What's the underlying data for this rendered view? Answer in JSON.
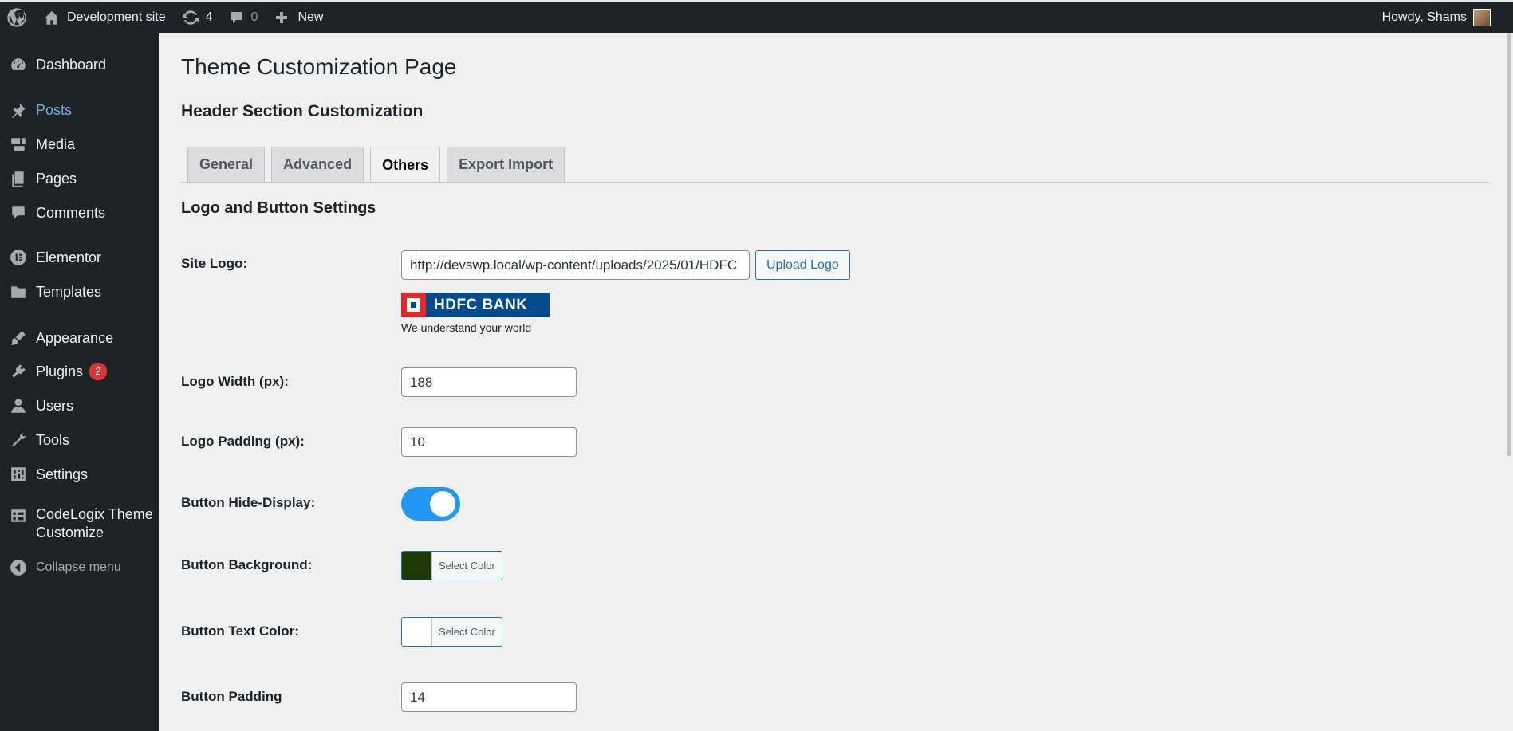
{
  "adminbar": {
    "site_name": "Development site",
    "updates_count": "4",
    "comments_count": "0",
    "new_label": "New",
    "howdy": "Howdy, Shams"
  },
  "sidebar": {
    "items": [
      {
        "label": "Dashboard",
        "icon": "dashboard-icon"
      },
      {
        "label": "Posts",
        "icon": "pin-icon"
      },
      {
        "label": "Media",
        "icon": "media-icon"
      },
      {
        "label": "Pages",
        "icon": "pages-icon"
      },
      {
        "label": "Comments",
        "icon": "comment-icon"
      },
      {
        "label": "Elementor",
        "icon": "elementor-icon"
      },
      {
        "label": "Templates",
        "icon": "folder-icon"
      },
      {
        "label": "Appearance",
        "icon": "brush-icon"
      },
      {
        "label": "Plugins",
        "icon": "plug-icon",
        "badge": "2"
      },
      {
        "label": "Users",
        "icon": "user-icon"
      },
      {
        "label": "Tools",
        "icon": "wrench-icon"
      },
      {
        "label": "Settings",
        "icon": "settings-icon"
      },
      {
        "label": "CodeLogix Theme Customize",
        "icon": "table-icon"
      },
      {
        "label": "Collapse menu",
        "icon": "collapse-icon"
      }
    ]
  },
  "main": {
    "page_title": "Theme Customization Page",
    "section_title": "Header Section Customization",
    "tabs": [
      {
        "label": "General"
      },
      {
        "label": "Advanced"
      },
      {
        "label": "Others"
      },
      {
        "label": "Export Import"
      }
    ],
    "subheading": "Logo and Button Settings",
    "fields": {
      "site_logo": {
        "label": "Site Logo:",
        "value": "http://devswp.local/wp-content/uploads/2025/01/HDFC",
        "button": "Upload Logo"
      },
      "logo_preview": {
        "brand": "HDFC BANK",
        "tagline": "We understand your world"
      },
      "logo_width": {
        "label": "Logo Width (px):",
        "value": "188"
      },
      "logo_padding": {
        "label": "Logo Padding (px):",
        "value": "10"
      },
      "button_display": {
        "label": "Button Hide-Display:",
        "checked": true
      },
      "button_background": {
        "label": "Button Background:",
        "button": "Select Color",
        "color": "#1f3a06"
      },
      "button_text_color": {
        "label": "Button Text Color:",
        "button": "Select Color",
        "color": "#ffffff"
      },
      "button_padding": {
        "label": "Button Padding",
        "value": "14"
      }
    }
  },
  "colors": {
    "adminbar_bg": "#1d2327",
    "accent": "#2271b1",
    "toggle_on": "#2196f3",
    "badge": "#d63638"
  }
}
